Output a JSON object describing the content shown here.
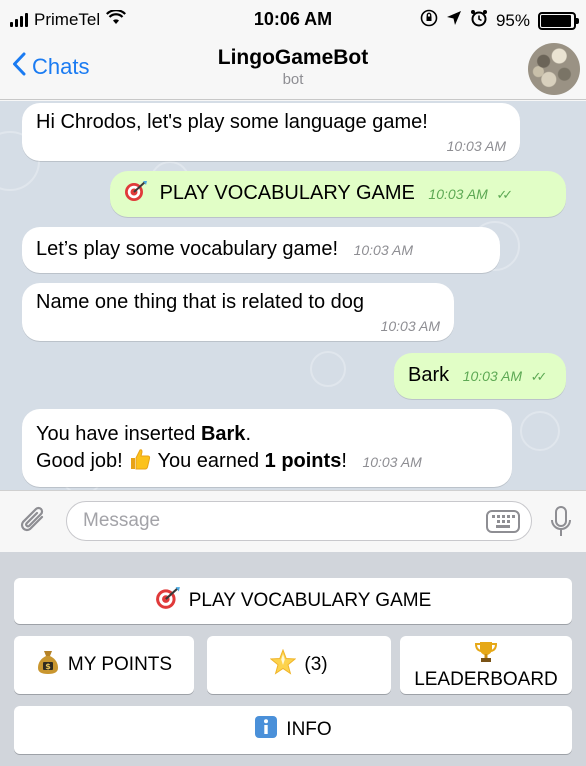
{
  "status_bar": {
    "carrier": "PrimeTel",
    "time": "10:06 AM",
    "battery": "95%",
    "battery_level": 0.95
  },
  "nav": {
    "back_label": "Chats",
    "title": "LingoGameBot",
    "subtitle": "bot"
  },
  "messages": [
    {
      "direction": "in",
      "text": "Hi Chrodos, let's play some language game!",
      "time": "10:03 AM"
    },
    {
      "direction": "out",
      "icon": "dart-target-icon",
      "text": "PLAY VOCABULARY GAME",
      "time": "10:03 AM"
    },
    {
      "direction": "in",
      "text": "Let’s play some vocabulary game!",
      "time": "10:03 AM"
    },
    {
      "direction": "in",
      "text": "Name one thing that is related to dog",
      "time": "10:03 AM"
    },
    {
      "direction": "out",
      "text": "Bark",
      "time": "10:03 AM"
    },
    {
      "direction": "in",
      "line1_prefix": "You have inserted ",
      "line1_bold": "Bark",
      "line1_suffix": ".",
      "line2_prefix": "Good job! ",
      "line2_icon": "thumbs-up-icon",
      "line2_middle": " You earned ",
      "line2_bold": "1 points",
      "line2_suffix": "!",
      "time": "10:03 AM"
    }
  ],
  "composer": {
    "placeholder": "Message"
  },
  "keyboard": {
    "play": {
      "icon": "dart-target-icon",
      "label": "PLAY VOCABULARY GAME"
    },
    "points": {
      "icon": "money-bag-icon",
      "label": "MY POINTS"
    },
    "stars": {
      "icon": "star-icon",
      "label": "(3)"
    },
    "leaderboard": {
      "icon": "trophy-icon",
      "label": "LEADERBOARD"
    },
    "info": {
      "icon": "info-icon",
      "label": "INFO"
    }
  },
  "colors": {
    "accent": "#1a7bf2",
    "chat_background": "#d5dde6",
    "outgoing_bubble": "#e1fec6",
    "incoming_bubble": "#ffffff",
    "outgoing_time": "#5da954"
  }
}
